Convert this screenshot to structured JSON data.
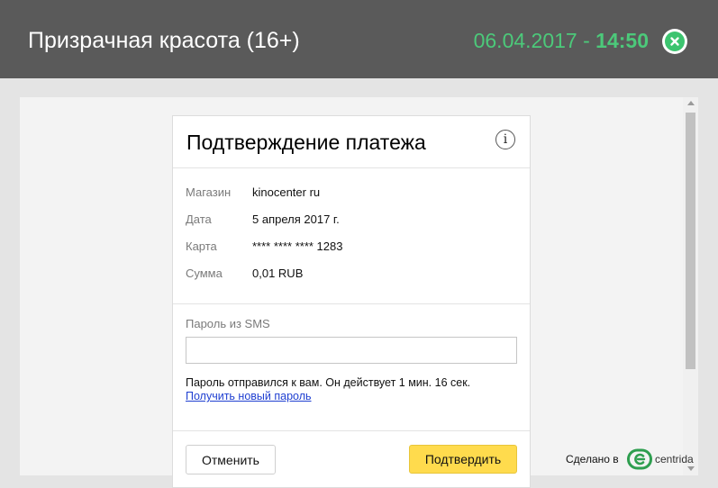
{
  "header": {
    "movie_title": "Призрачная красота (16+)",
    "date": "06.04.2017",
    "separator": "-",
    "time": "14:50",
    "accent_color": "#4cc97a"
  },
  "card": {
    "title": "Подтверждение платежа",
    "info_glyph": "i",
    "details": [
      {
        "label": "Магазин",
        "value": "kinocenter ru"
      },
      {
        "label": "Дата",
        "value": "5 апреля 2017 г."
      },
      {
        "label": "Карта",
        "value": "**** **** **** 1283"
      },
      {
        "label": "Сумма",
        "value": "0,01 RUB"
      }
    ],
    "sms_label": "Пароль из SMS",
    "sms_value": "",
    "sms_note": "Пароль отправился к вам. Он действует 1 мин. 16 сек.",
    "new_password_link": "Получить новый пароль",
    "cancel_label": "Отменить",
    "confirm_label": "Подтвердить",
    "confirm_color": "#ffdb4d"
  },
  "footer": {
    "made_in": "Сделано в",
    "brand": "centrida",
    "brand_color": "#2e9e4f"
  },
  "icons": {
    "close": "close-icon",
    "info": "info-icon",
    "logo": "centrida-logo-icon"
  }
}
